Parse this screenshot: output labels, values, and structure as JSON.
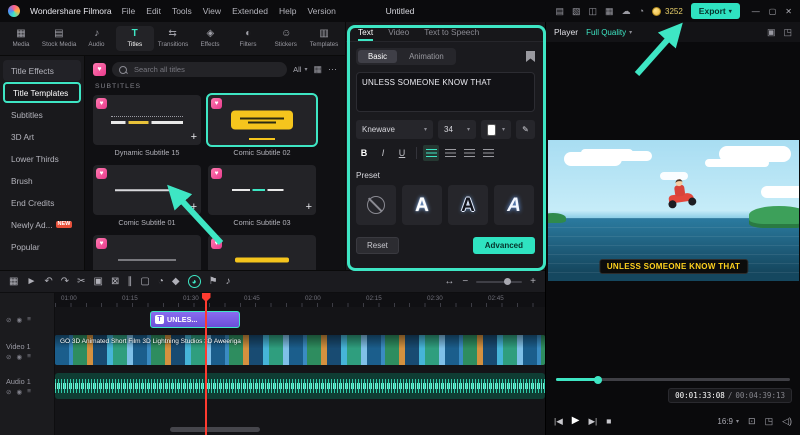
{
  "ui": {
    "caret_down": "▾",
    "plus": "+",
    "heart": "♥",
    "ellipsis": "⋯",
    "slash": "/",
    "eyedropper": "✎"
  },
  "colors": {
    "accent": "#3ee6c4",
    "heart_pink": "#e83a8c",
    "playhead_red": "#ff3b30",
    "subtitle_yellow": "#ffd21f",
    "clip_purple": "#7a5ce8"
  },
  "topbar": {
    "app_name": "Wondershare Filmora",
    "menus": [
      "File",
      "Edit",
      "Tools",
      "View",
      "Extended",
      "Help",
      "Version"
    ],
    "project_title": "Untitled",
    "icons": [
      {
        "name": "gift-icon",
        "glyph": "▤"
      },
      {
        "name": "shortcuts-icon",
        "glyph": "▧"
      },
      {
        "name": "layout-icon",
        "glyph": "◫"
      },
      {
        "name": "screen-record-icon",
        "glyph": "▦"
      },
      {
        "name": "cloud-icon",
        "glyph": "☁"
      },
      {
        "name": "notifications-icon",
        "glyph": "◔"
      }
    ],
    "coin_count": "3252",
    "export_label": "Export",
    "window_controls": {
      "minimize": "—",
      "maximize": "▢",
      "close": "✕"
    }
  },
  "media_tabs": {
    "items": [
      {
        "label": "Media",
        "glyph": "▦",
        "active": false
      },
      {
        "label": "Stock Media",
        "glyph": "▤",
        "active": false
      },
      {
        "label": "Audio",
        "glyph": "♪",
        "active": false
      },
      {
        "label": "Titles",
        "glyph": "T",
        "active": true
      },
      {
        "label": "Transitions",
        "glyph": "⇆",
        "active": false
      },
      {
        "label": "Effects",
        "glyph": "◈",
        "active": false
      },
      {
        "label": "Filters",
        "glyph": "◐",
        "active": false
      },
      {
        "label": "Stickers",
        "glyph": "☺",
        "active": false
      },
      {
        "label": "Templates",
        "glyph": "▥",
        "active": false
      }
    ]
  },
  "sidebar": {
    "items": [
      {
        "label": "Title Effects",
        "active": false
      },
      {
        "label": "Title Templates",
        "active": true
      },
      {
        "label": "Subtitles",
        "active": false
      },
      {
        "label": "3D Art",
        "active": false
      },
      {
        "label": "Lower Thirds",
        "active": false
      },
      {
        "label": "Brush",
        "active": false
      },
      {
        "label": "End Credits",
        "active": false
      },
      {
        "label": "Newly Ad...",
        "badge": "NEW",
        "active": false
      },
      {
        "label": "Popular",
        "active": false
      }
    ]
  },
  "library": {
    "search_placeholder": "Search all titles",
    "filter_label": "All",
    "grid_icon": "▦",
    "more_icon": "⋯",
    "section": "SUBTITLES",
    "items": [
      {
        "name": "Dynamic Subtitle 15",
        "selected": false
      },
      {
        "name": "Comic Subtitle 02",
        "selected": true
      },
      {
        "name": "Comic Subtitle 01",
        "selected": false
      },
      {
        "name": "Comic Subtitle 03",
        "selected": false
      },
      {
        "name": "",
        "selected": false
      },
      {
        "name": "",
        "selected": false
      }
    ]
  },
  "properties": {
    "tabs": [
      {
        "label": "Text",
        "active": true
      },
      {
        "label": "Video",
        "active": false
      },
      {
        "label": "Text to Speech",
        "active": false
      }
    ],
    "subtabs": [
      {
        "label": "Basic",
        "active": true
      },
      {
        "label": "Animation",
        "active": false
      }
    ],
    "text_value": "UNLESS SOMEONE KNOW THAT",
    "font_family": "Knewave",
    "font_size": "34",
    "bold_label": "B",
    "italic_label": "I",
    "underline_label": "U",
    "preset_label": "Preset",
    "preset_letter": "A",
    "reset_label": "Reset",
    "advanced_label": "Advanced"
  },
  "player": {
    "label": "Player",
    "quality": "Full Quality",
    "header_icons": [
      {
        "name": "dual-display-icon",
        "glyph": "▣"
      },
      {
        "name": "detach-player-icon",
        "glyph": "◳"
      }
    ],
    "subtitle_text": "UNLESS SOMEONE KNOW THAT",
    "current_time": "00:01:33:08",
    "total_time": "00:04:39:13",
    "aspect_ratio": "16:9",
    "transport": [
      {
        "name": "previous-frame-button",
        "glyph": "|◀"
      },
      {
        "name": "play-button",
        "glyph": "▶"
      },
      {
        "name": "next-frame-button",
        "glyph": "▶|"
      },
      {
        "name": "stop-button",
        "glyph": "■"
      }
    ],
    "right_icons": [
      {
        "name": "snapshot-icon",
        "glyph": "⊡"
      },
      {
        "name": "fit-screen-icon",
        "glyph": "◳"
      },
      {
        "name": "volume-icon",
        "glyph": "◁)"
      }
    ]
  },
  "timeline": {
    "tools": [
      {
        "name": "manage-tracks-icon",
        "glyph": "▦"
      },
      {
        "name": "pointer-tool-icon",
        "glyph": "►"
      },
      {
        "name": "undo-icon",
        "glyph": "↶"
      },
      {
        "name": "redo-icon",
        "glyph": "↷"
      },
      {
        "name": "scissors-icon",
        "glyph": "✂"
      },
      {
        "name": "copy-icon",
        "glyph": "▣"
      },
      {
        "name": "delete-icon",
        "glyph": "⊠"
      },
      {
        "name": "split-icon",
        "glyph": "∥"
      },
      {
        "name": "crop-icon",
        "glyph": "▢"
      },
      {
        "name": "speed-icon",
        "glyph": "◔"
      },
      {
        "name": "keyframe-icon",
        "glyph": "◆"
      },
      {
        "name": "chroma-key-icon",
        "glyph": "◕"
      },
      {
        "name": "marker-icon",
        "glyph": "⚑"
      },
      {
        "name": "voiceover-icon",
        "glyph": "♪"
      }
    ],
    "zoom_fit": "↔",
    "zoom_out": "−",
    "zoom_in": "+",
    "ruler_labels": [
      "01:00",
      "01:15",
      "01:30",
      "01:45",
      "02:00",
      "02:15",
      "02:30",
      "02:45"
    ],
    "title_clip": {
      "badge": "T",
      "label": "UNLES..."
    },
    "video_track": {
      "label": "Video 1",
      "overlay_text": "GO 3D Animated Short Film 3D    Lightning Studios 3D    Aweeriga"
    },
    "audio_track": {
      "label": "Audio 1"
    },
    "track_icons": [
      {
        "name": "lock-icon",
        "glyph": "⊘"
      },
      {
        "name": "visibility-icon",
        "glyph": "◉"
      },
      {
        "name": "options-icon",
        "glyph": "≡"
      }
    ]
  }
}
